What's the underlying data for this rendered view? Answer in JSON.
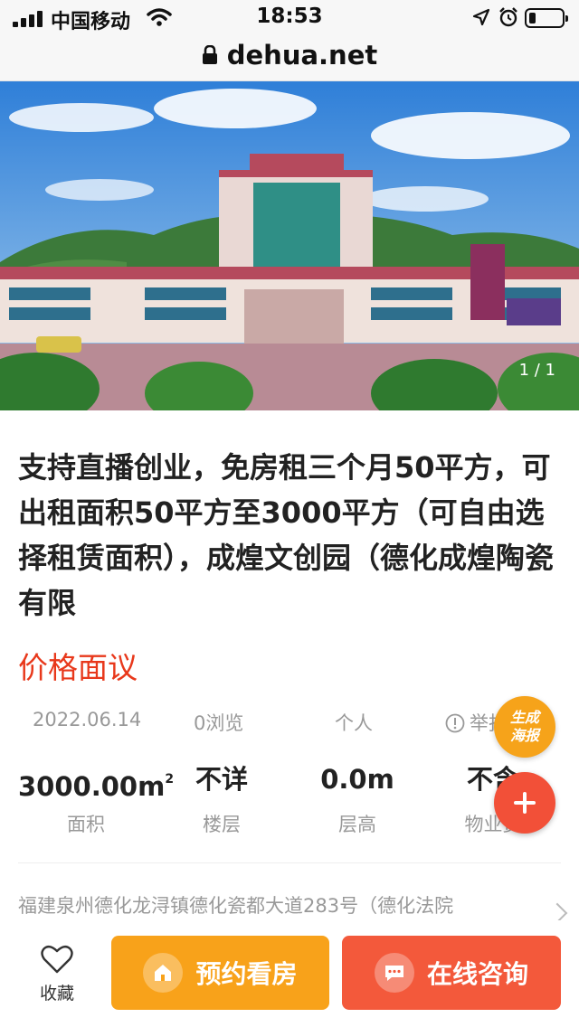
{
  "status_bar": {
    "carrier": "中国移动",
    "time": "18:53"
  },
  "browser": {
    "url": "dehua.net"
  },
  "gallery": {
    "counter": "1 / 1"
  },
  "listing": {
    "title": "支持直播创业，免房租三个月50平方，可出租面积50平方至3000平方（可自由选择租赁面积），成煌文创园（德化成煌陶瓷有限",
    "price": "价格面议",
    "date": "2022.06.14",
    "views": "0浏览",
    "publisher": "个人",
    "report": "举报",
    "stats": [
      {
        "value": "3000.00m",
        "unit_sup": "2",
        "label": "面积"
      },
      {
        "value": "不详",
        "label": "楼层"
      },
      {
        "value": "0.0m",
        "label": "层高"
      },
      {
        "value": "不含",
        "label": "物业费"
      }
    ],
    "address": "福建泉州德化龙浔镇德化瓷都大道283号（德化法院"
  },
  "floating": {
    "poster_label_1": "生成",
    "poster_label_2": "海报"
  },
  "bottom_bar": {
    "favorite_label": "收藏",
    "view_label": "预约看房",
    "chat_label": "在线咨询"
  },
  "colors": {
    "price_red": "#e8381b",
    "orange": "#f8a21a",
    "red_orange": "#f3593b"
  }
}
